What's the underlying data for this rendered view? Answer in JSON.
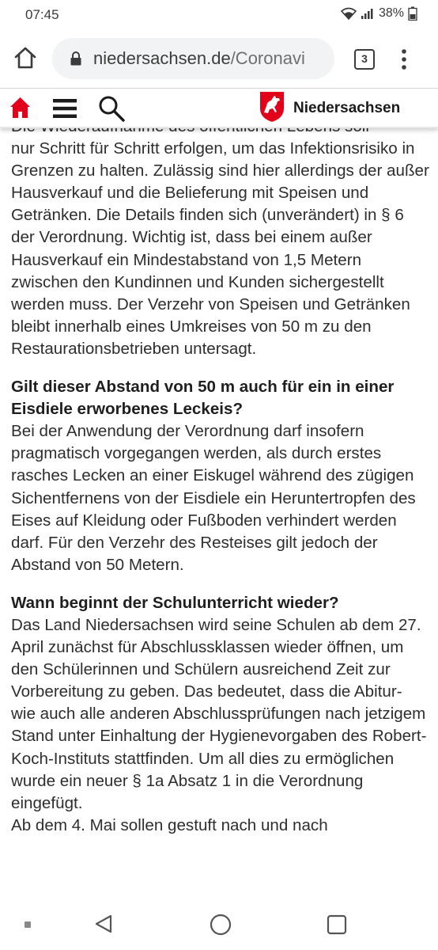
{
  "status_bar": {
    "time": "07:45",
    "battery": "38%"
  },
  "browser": {
    "url_domain": "niedersachsen.de",
    "url_path": "/Coronavi",
    "tab_count": "3"
  },
  "site_header": {
    "brand": "Niedersachsen"
  },
  "article": {
    "intro_partial_line": "Die Wiederaufnahme des öffentlichen Lebens soll",
    "intro_text": "nur Schritt für Schritt erfolgen, um das Infektionsrisiko in Grenzen zu halten. Zulässig sind hier allerdings der außer Hausverkauf und die Belieferung mit Speisen und Getränken. Die Details finden sich (unverändert) in § 6 der Verordnung. Wichtig ist, dass bei einem außer Hausverkauf ein Mindestabstand von 1,5 Metern zwischen den Kundinnen und Kunden sichergestellt werden muss. Der Verzehr von Speisen und Getränken bleibt innerhalb eines Umkreises von 50 m zu den Restaurationsbetrieben untersagt.",
    "q1_heading": "Gilt dieser Abstand von 50 m auch für ein in einer Eisdiele erworbenes Leckeis?",
    "q1_answer": "Bei der Anwendung der Verordnung darf insofern pragmatisch vorgegangen werden, als durch erstes rasches Lecken an einer Eiskugel während des zügigen Sichentfernens von der Eisdiele ein Heruntertropfen des Eises auf Kleidung oder Fußboden verhindert werden darf. Für den Verzehr des Resteises gilt jedoch der Abstand von 50 Metern.",
    "q2_heading": "Wann beginnt der Schulunterricht wieder?",
    "q2_answer": "Das Land Niedersachsen wird seine Schulen ab dem 27. April zunächst für Abschlussklassen wieder öffnen, um den Schülerinnen und Schülern ausreichend Zeit zur Vorbereitung zu geben. Das bedeutet, dass die Abitur- wie auch alle anderen Abschlussprüfungen nach jetzigem Stand unter Einhaltung der Hygienevorgaben des Robert-Koch-Instituts stattfinden. Um all dies zu ermöglichen wurde ein neuer § 1a Absatz 1 in die Verordnung eingefügt.",
    "q2_continuation": "Ab dem 4. Mai sollen gestuft nach und nach"
  },
  "icons": {
    "home": "home-icon",
    "lock": "lock-icon",
    "tabs": "tab-switcher-icon",
    "overflow": "more-vert-icon",
    "site_home": "site-home-icon",
    "site_menu": "hamburger-menu-icon",
    "site_search": "search-icon",
    "site_logo": "niedersachsen-horse-logo",
    "nav_back": "back-icon",
    "nav_home": "nav-home-icon",
    "nav_recent": "recent-apps-icon"
  },
  "colors": {
    "accent_red": "#e2001a",
    "text": "#2e2e2e"
  }
}
